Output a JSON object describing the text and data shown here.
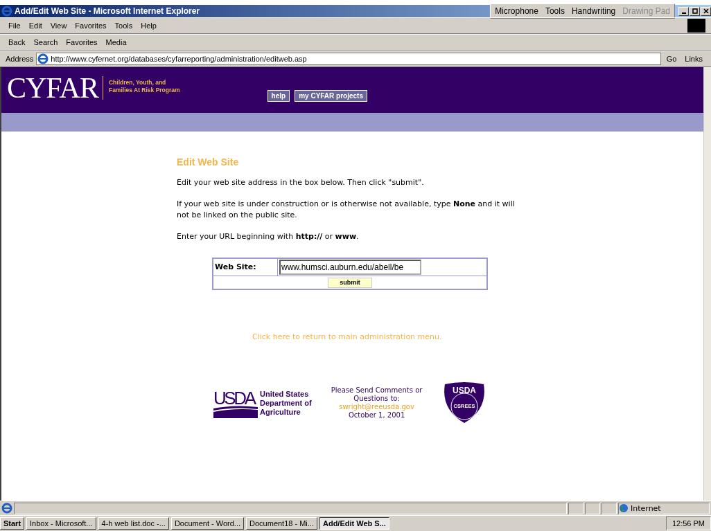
{
  "window": {
    "title": "Add/Edit Web Site - Microsoft Internet Explorer"
  },
  "language_bar": [
    {
      "label": "Microphone",
      "disabled": false
    },
    {
      "label": "Tools",
      "disabled": false
    },
    {
      "label": "Handwriting",
      "disabled": false
    },
    {
      "label": "Drawing Pad",
      "disabled": true
    }
  ],
  "menu": [
    "File",
    "Edit",
    "View",
    "Favorites",
    "Tools",
    "Help"
  ],
  "toolbar": [
    {
      "label": "Back"
    },
    {
      "label": "Search"
    },
    {
      "label": "Favorites"
    },
    {
      "label": "Media"
    }
  ],
  "address": {
    "label": "Address",
    "value": "http://www.cyfernet.org/databases/cyfarreporting/administration/editweb.asp",
    "go": "Go",
    "links": "Links"
  },
  "header": {
    "logo": "CYFAR",
    "tagline": [
      "Children, Youth, and",
      "Families At Risk Program"
    ],
    "nav": [
      "help",
      "my CYFAR projects"
    ]
  },
  "content": {
    "heading": "Edit Web Site",
    "paragraphs": [
      "Edit your web site address in the box below. Then click \"submit\".",
      "If your web site is under construction or is otherwise not available, type **None** and it will not be linked on the public site.",
      "Enter your URL beginning with **http://** or **www**."
    ],
    "form": {
      "label": "Web Site:",
      "value": "www.humsci.auburn.edu/abell/be",
      "submit": "submit"
    },
    "return_link": "Click here to return to main administration menu."
  },
  "footer": {
    "usda_mark": "USDA",
    "usda_name": [
      "United States",
      "Department of",
      "Agriculture"
    ],
    "contact": [
      "Please Send Comments or",
      "Questions to:"
    ],
    "email": "swright@reeusda.gov",
    "date": "October 1, 2001",
    "seal": "USDA",
    "seal_ring": "CSREES"
  },
  "status_bar": {
    "zone": "Internet"
  },
  "taskbar": {
    "start": "Start",
    "tasks": [
      {
        "label": "Inbox - Microsoft...",
        "selected": false
      },
      {
        "label": "4-h web list.doc -...",
        "selected": false
      },
      {
        "label": "Document - Word...",
        "selected": false
      },
      {
        "label": "Document18 - Mi...",
        "selected": false
      },
      {
        "label": "Add/Edit Web S...",
        "selected": true
      }
    ],
    "clock": "12:56 PM"
  }
}
